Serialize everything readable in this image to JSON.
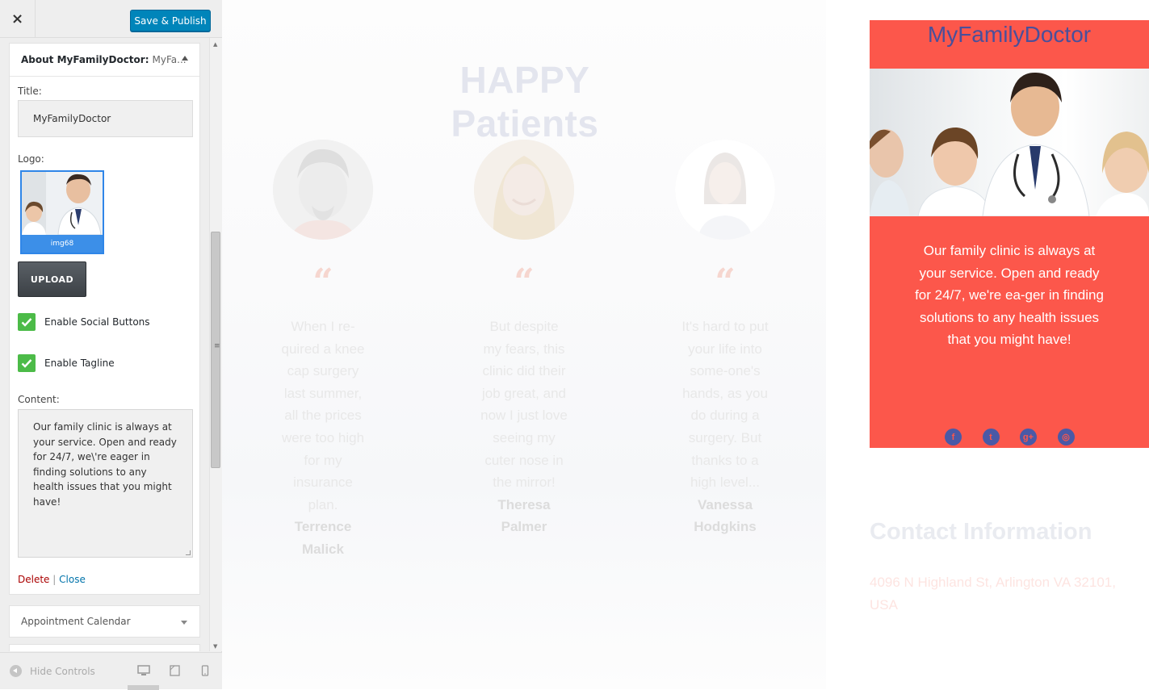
{
  "sidebar": {
    "close_icon": "×",
    "publish_label": "Save & Publish",
    "widget": {
      "title_strong": "About MyFamilyDoctor:",
      "title_sub": "MyFa...",
      "title_label": "Title:",
      "title_value": "MyFamilyDoctor",
      "logo_label": "Logo:",
      "logo_filename": "img68",
      "upload_label": "UPLOAD",
      "social_label": "Enable Social Buttons",
      "tagline_label": "Enable Tagline",
      "content_label": "Content:",
      "content_value": "Our family clinic is always at your service. Open and ready for 24/7, we\\'re eager in finding solutions to any health issues that you might have!",
      "delete_label": "Delete",
      "separator": "|",
      "close_label": "Close"
    },
    "next_widget_label": "Appointment Calendar",
    "hide_controls_label": "Hide Controls"
  },
  "preview": {
    "happy_title": "HAPPY Patients",
    "quote_glyph": "“",
    "testimonials": [
      {
        "text": "When I re-quired a knee cap surgery last summer, all the prices were too high for my insurance plan.",
        "author": "Terrence Malick"
      },
      {
        "text": "But despite my fears, this clinic did their job great, and now I just love seeing my cuter nose in the mirror!",
        "author": "Theresa Palmer"
      },
      {
        "text": "It's hard to put your life into some-one's hands, as you do during a surgery. But thanks to a high level...",
        "author": "Vanessa Hodgkins"
      }
    ],
    "about": {
      "title": "MyFamilyDoctor",
      "text": "Our family clinic is always at your service. Open and ready for 24/7, we're ea-ger in finding solutions to any health issues that you might have!",
      "social": [
        {
          "icon": "facebook-icon",
          "glyph": "f"
        },
        {
          "icon": "twitter-icon",
          "glyph": "t"
        },
        {
          "icon": "google-plus-icon",
          "glyph": "g+"
        },
        {
          "icon": "instagram-icon",
          "glyph": "◎"
        }
      ]
    },
    "contact_title": "Contact Information",
    "contact_address": "4096 N Highland St, Arlington VA 32101, USA"
  },
  "colors": {
    "publish_blue": "#0085ba",
    "checkbox_green": "#4cbb48",
    "card_red": "#fc574b",
    "brand_navy": "#4a4f9a"
  }
}
